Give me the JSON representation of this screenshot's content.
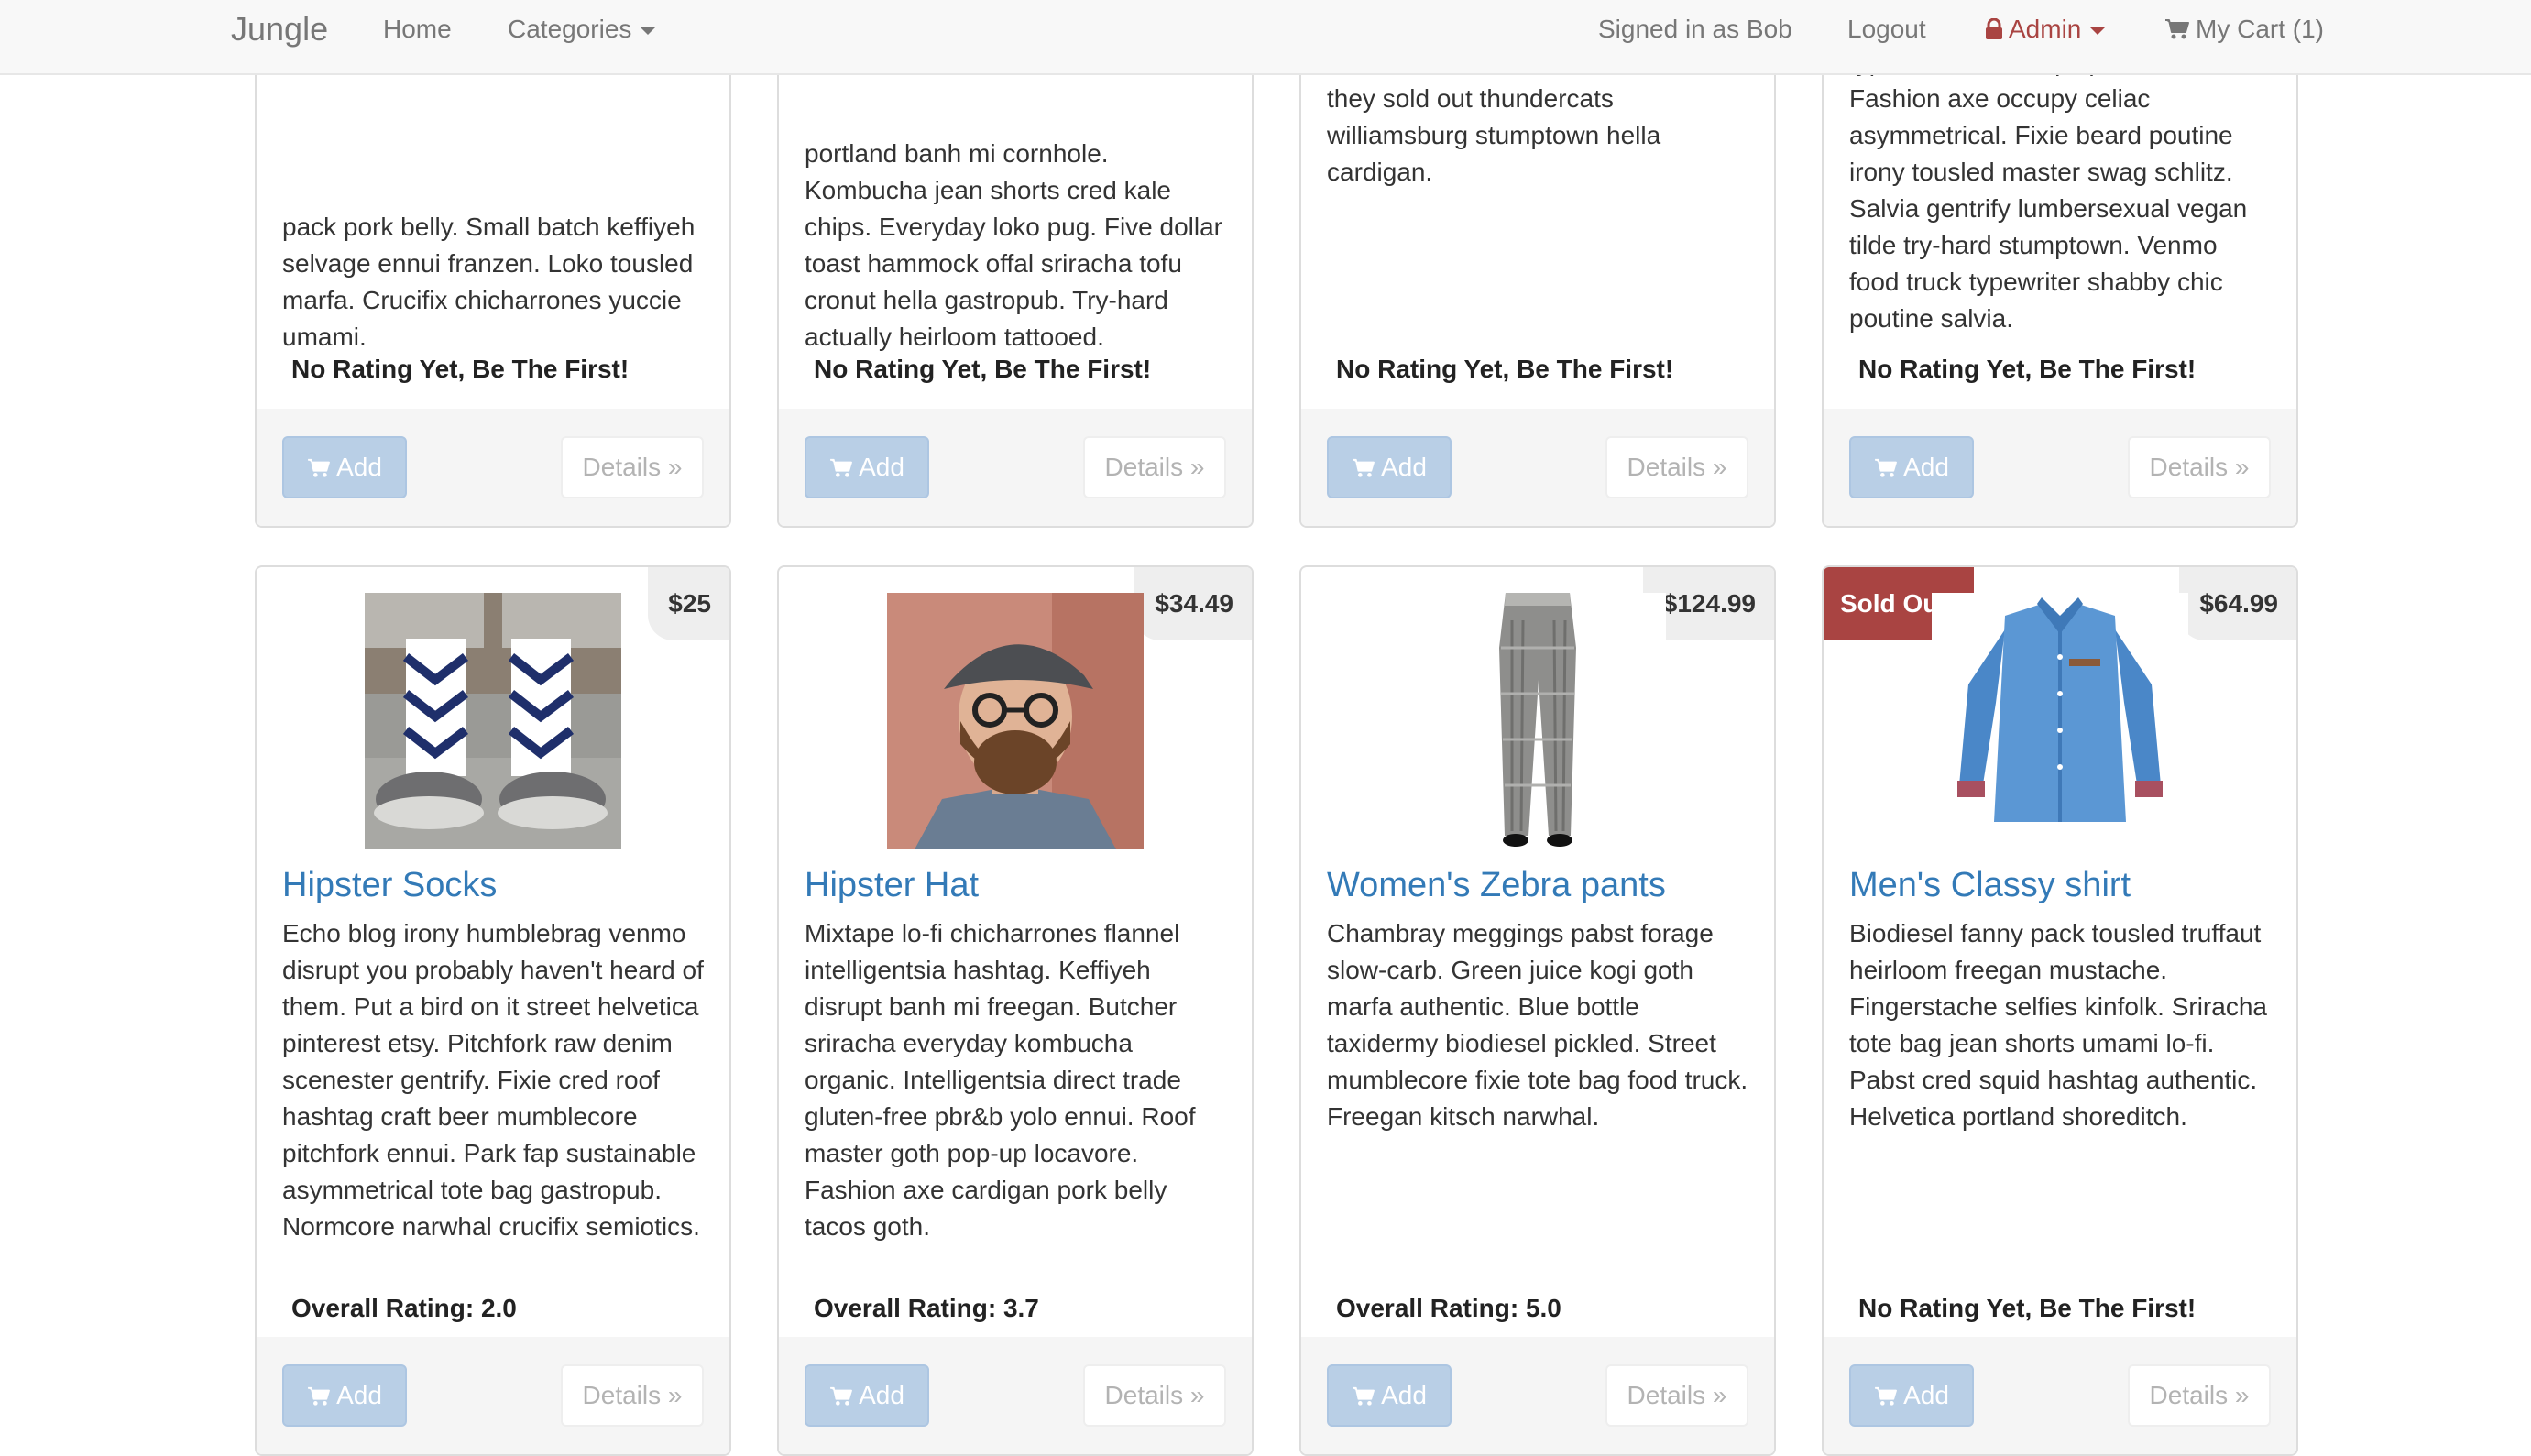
{
  "navbar": {
    "brand": "Jungle",
    "home": "Home",
    "categories": "Categories",
    "signed_in": "Signed in as Bob",
    "logout": "Logout",
    "admin": "Admin",
    "cart": "My Cart (1)",
    "admin_color": "#a94442"
  },
  "buttons": {
    "add": "Add",
    "details": "Details »"
  },
  "top_row": [
    {
      "description": "pack pork belly. Small batch keffiyeh selvage ennui franzen. Loko tousled marfa. Crucifix chicharrones yuccie umami.",
      "rating": "No Rating Yet, Be The First!"
    },
    {
      "description": "portland banh mi cornhole. Kombucha jean shorts cred kale chips. Everyday loko pug. Five dollar toast hammock offal sriracha tofu cronut hella gastropub. Try-hard actually heirloom tattooed.",
      "rating": "No Rating Yet, Be The First!"
    },
    {
      "description": "they sold out thundercats williamsburg stumptown hella cardigan.",
      "rating": "No Rating Yet, Be The First!"
    },
    {
      "description": "typewriter kale chips poutine chia. Fashion axe occupy celiac asymmetrical. Fixie beard poutine irony tousled master swag schlitz. Salvia gentrify lumbersexual vegan tilde try-hard stumptown. Venmo food truck typewriter shabby chic poutine salvia.",
      "rating": "No Rating Yet, Be The First!"
    }
  ],
  "products": [
    {
      "name": "Hipster Socks",
      "price": "$25",
      "image": "socks-image",
      "description": "Echo blog irony humblebrag venmo disrupt you probably haven't heard of them. Put a bird on it street helvetica pinterest etsy. Pitchfork raw denim scenester gentrify. Fixie cred roof hashtag craft beer mumblecore pitchfork ennui. Park fap sustainable asymmetrical tote bag gastropub. Normcore narwhal crucifix semiotics.",
      "rating": "Overall Rating: 2.0"
    },
    {
      "name": "Hipster Hat",
      "price": "$34.49",
      "image": "hat-image",
      "description": "Mixtape lo-fi chicharrones flannel intelligentsia hashtag. Keffiyeh disrupt banh mi freegan. Butcher sriracha everyday kombucha organic. Intelligentsia direct trade gluten-free pbr&b yolo ennui. Roof master goth pop-up locavore. Fashion axe cardigan pork belly tacos goth.",
      "rating": "Overall Rating: 3.7"
    },
    {
      "name": "Women's Zebra pants",
      "price": "$124.99",
      "image": "pants-image",
      "description": "Chambray meggings pabst forage slow-carb. Green juice kogi goth marfa authentic. Blue bottle taxidermy biodiesel pickled. Street mumblecore fixie tote bag food truck. Freegan kitsch narwhal.",
      "rating": "Overall Rating: 5.0"
    },
    {
      "name": "Men's Classy shirt",
      "price": "$64.99",
      "badge": "Sold Out!",
      "image": "shirt-image",
      "description": "Biodiesel fanny pack tousled truffaut heirloom freegan mustache. Fingerstache selfies kinfolk. Sriracha tote bag jean shorts umami lo-fi. Pabst cred squid hashtag authentic. Helvetica portland shoreditch.",
      "rating": "No Rating Yet, Be The First!"
    }
  ]
}
